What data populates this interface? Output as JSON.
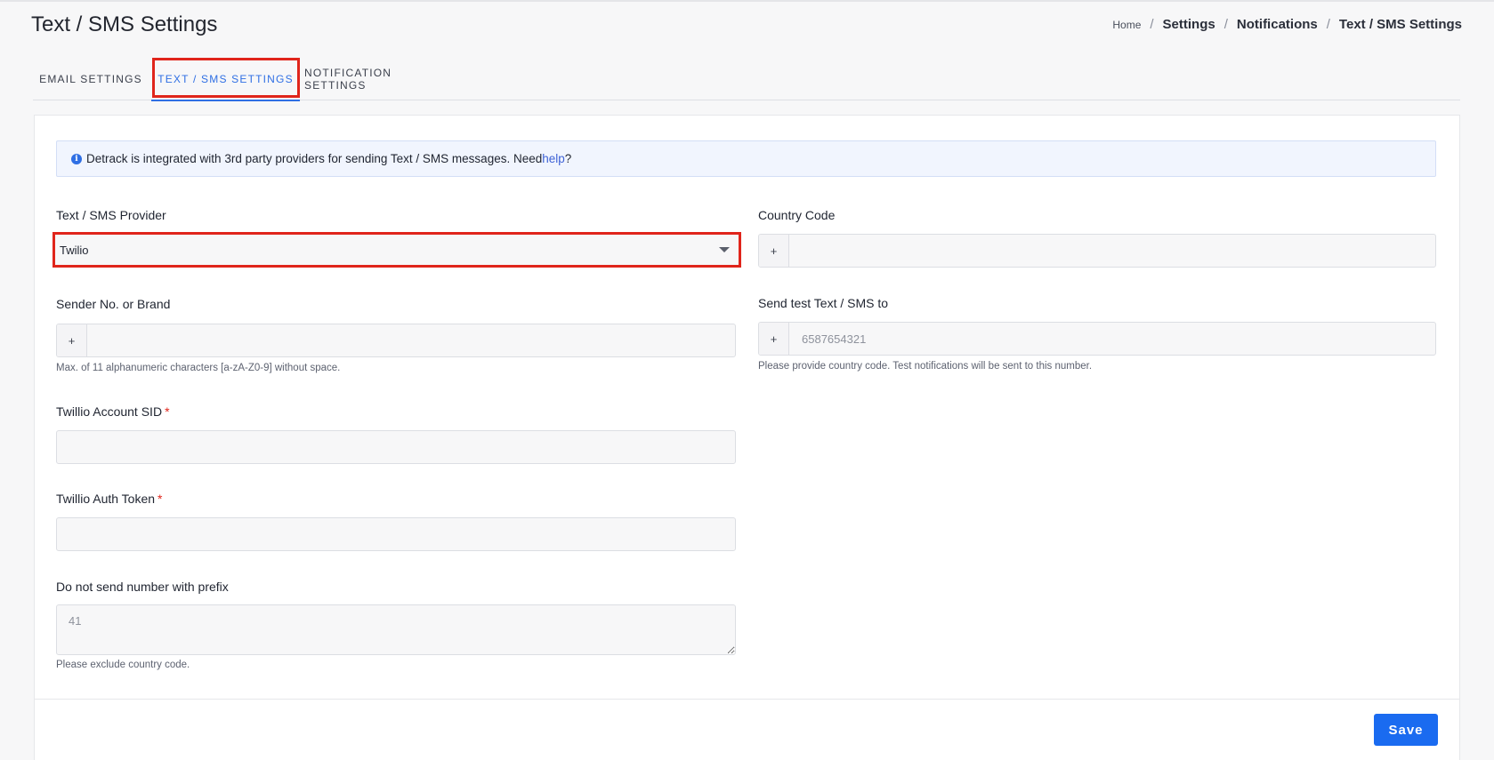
{
  "page": {
    "title": "Text / SMS Settings"
  },
  "breadcrumb": {
    "home": "Home",
    "settings": "Settings",
    "notifications": "Notifications",
    "current": "Text / SMS Settings",
    "separator": "/"
  },
  "tabs": [
    {
      "label": "EMAIL SETTINGS",
      "active": false
    },
    {
      "label": "TEXT / SMS SETTINGS",
      "active": true
    },
    {
      "label": "NOTIFICATION SETTINGS",
      "active": false
    }
  ],
  "info": {
    "text": "Detrack is integrated with 3rd party providers for sending Text / SMS messages. Need ",
    "link": "help",
    "suffix": "?",
    "icon": "info-icon"
  },
  "form": {
    "provider": {
      "label": "Text / SMS Provider",
      "value": "Twilio"
    },
    "country_code": {
      "label": "Country Code",
      "prefix": "+",
      "value": ""
    },
    "sender": {
      "label": "Sender No. or Brand",
      "prefix": "+",
      "value": "",
      "help": "Max. of 11 alphanumeric characters [a-zA-Z0-9] without space."
    },
    "test_to": {
      "label": "Send test Text / SMS to",
      "prefix": "+",
      "placeholder": "6587654321",
      "help": "Please provide country code. Test notifications will be sent to this number."
    },
    "account_sid": {
      "label": "Twillio Account SID",
      "required_mark": "*",
      "value": ""
    },
    "auth_token": {
      "label": "Twillio Auth Token",
      "required_mark": "*",
      "value": ""
    },
    "exclude_prefix": {
      "label": "Do not send number with prefix",
      "placeholder": "41",
      "help": "Please exclude country code."
    }
  },
  "actions": {
    "save_label": "Save"
  },
  "colors": {
    "accent": "#1a6bf0",
    "highlight": "#e0251b",
    "link": "#3f63d6"
  }
}
